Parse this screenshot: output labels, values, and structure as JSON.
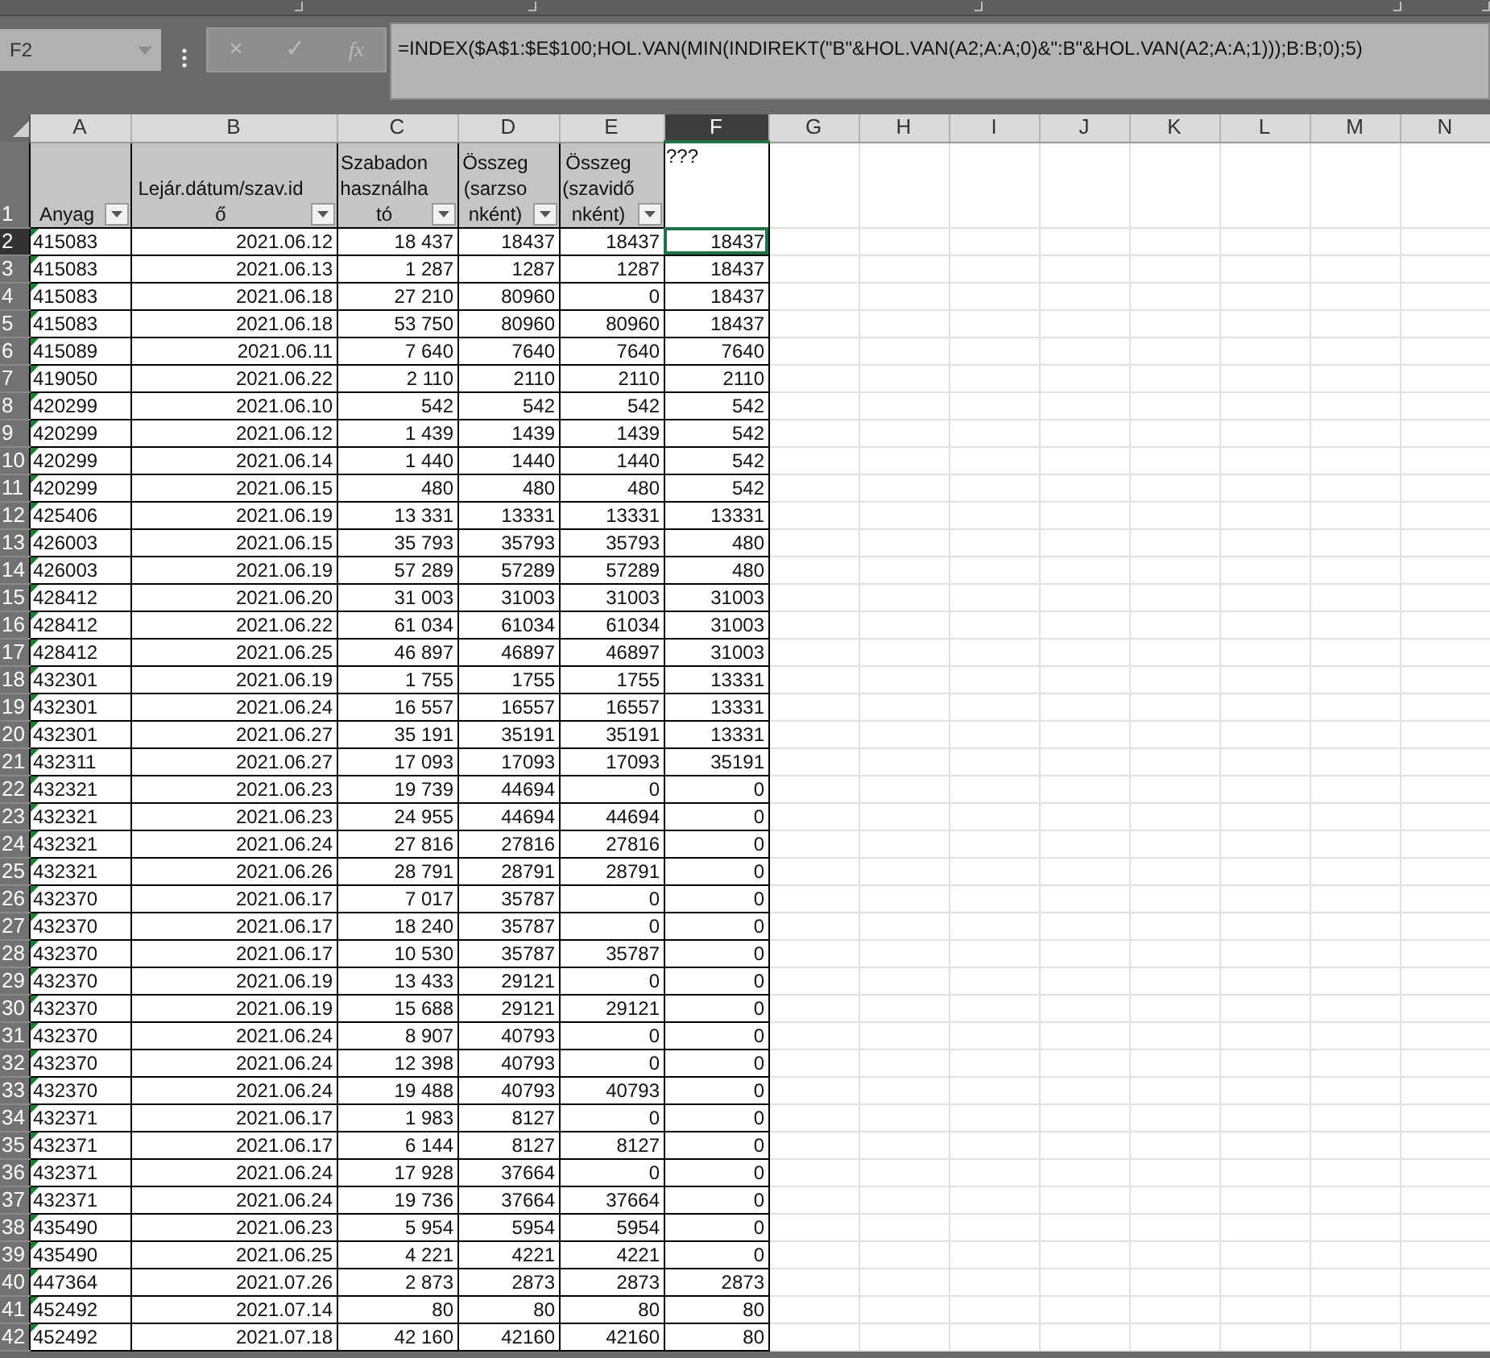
{
  "formula_bar": {
    "name_box": "F2",
    "cancel": "×",
    "enter": "✓",
    "function": "fx",
    "formula": "=INDEX($A$1:$E$100;HOL.VAN(MIN(INDIREKT(\"B\"&HOL.VAN(A2;A:A;0)&\":B\"&HOL.VAN(A2;A:A;1)));B:B;0);5)"
  },
  "columns": [
    {
      "letter": "A",
      "selected": false,
      "flagged": true
    },
    {
      "letter": "B",
      "selected": false,
      "flagged": false
    },
    {
      "letter": "C",
      "selected": false,
      "flagged": false
    },
    {
      "letter": "D",
      "selected": false,
      "flagged": false
    },
    {
      "letter": "E",
      "selected": false,
      "flagged": false
    },
    {
      "letter": "F",
      "selected": true,
      "flagged": false
    },
    {
      "letter": "G",
      "selected": false
    },
    {
      "letter": "H",
      "selected": false
    },
    {
      "letter": "I",
      "selected": false
    },
    {
      "letter": "J",
      "selected": false
    },
    {
      "letter": "K",
      "selected": false
    },
    {
      "letter": "L",
      "selected": false
    },
    {
      "letter": "M",
      "selected": false
    },
    {
      "letter": "N",
      "selected": false
    }
  ],
  "header_row": {
    "number": "1",
    "selected": false,
    "cells": [
      {
        "text": "Anyag",
        "kind": "filtered"
      },
      {
        "text": "Lejár.dátum/szav.idő",
        "kind": "filtered"
      },
      {
        "text": "Szabadon használható",
        "kind": "filtered"
      },
      {
        "text": "Összeg (sarzsonként)",
        "kind": "filtered"
      },
      {
        "text": "Összeg (szavidőnként)",
        "kind": "filtered"
      },
      {
        "text": "???",
        "kind": "plain"
      }
    ]
  },
  "rows": [
    {
      "number": "2",
      "selected": true,
      "cells": [
        "415083",
        "2021.06.12",
        "18 437",
        "18437",
        "18437",
        "18437"
      ]
    },
    {
      "number": "3",
      "selected": false,
      "cells": [
        "415083",
        "2021.06.13",
        "1 287",
        "1287",
        "1287",
        "18437"
      ]
    },
    {
      "number": "4",
      "selected": false,
      "cells": [
        "415083",
        "2021.06.18",
        "27 210",
        "80960",
        "0",
        "18437"
      ]
    },
    {
      "number": "5",
      "selected": false,
      "cells": [
        "415083",
        "2021.06.18",
        "53 750",
        "80960",
        "80960",
        "18437"
      ]
    },
    {
      "number": "6",
      "selected": false,
      "cells": [
        "415089",
        "2021.06.11",
        "7 640",
        "7640",
        "7640",
        "7640"
      ]
    },
    {
      "number": "7",
      "selected": false,
      "cells": [
        "419050",
        "2021.06.22",
        "2 110",
        "2110",
        "2110",
        "2110"
      ]
    },
    {
      "number": "8",
      "selected": false,
      "cells": [
        "420299",
        "2021.06.10",
        "542",
        "542",
        "542",
        "542"
      ]
    },
    {
      "number": "9",
      "selected": false,
      "cells": [
        "420299",
        "2021.06.12",
        "1 439",
        "1439",
        "1439",
        "542"
      ]
    },
    {
      "number": "10",
      "selected": false,
      "cells": [
        "420299",
        "2021.06.14",
        "1 440",
        "1440",
        "1440",
        "542"
      ]
    },
    {
      "number": "11",
      "selected": false,
      "cells": [
        "420299",
        "2021.06.15",
        "480",
        "480",
        "480",
        "542"
      ]
    },
    {
      "number": "12",
      "selected": false,
      "cells": [
        "425406",
        "2021.06.19",
        "13 331",
        "13331",
        "13331",
        "13331"
      ]
    },
    {
      "number": "13",
      "selected": false,
      "cells": [
        "426003",
        "2021.06.15",
        "35 793",
        "35793",
        "35793",
        "480"
      ]
    },
    {
      "number": "14",
      "selected": false,
      "cells": [
        "426003",
        "2021.06.19",
        "57 289",
        "57289",
        "57289",
        "480"
      ]
    },
    {
      "number": "15",
      "selected": false,
      "cells": [
        "428412",
        "2021.06.20",
        "31 003",
        "31003",
        "31003",
        "31003"
      ]
    },
    {
      "number": "16",
      "selected": false,
      "cells": [
        "428412",
        "2021.06.22",
        "61 034",
        "61034",
        "61034",
        "31003"
      ]
    },
    {
      "number": "17",
      "selected": false,
      "cells": [
        "428412",
        "2021.06.25",
        "46 897",
        "46897",
        "46897",
        "31003"
      ]
    },
    {
      "number": "18",
      "selected": false,
      "cells": [
        "432301",
        "2021.06.19",
        "1 755",
        "1755",
        "1755",
        "13331"
      ]
    },
    {
      "number": "19",
      "selected": false,
      "cells": [
        "432301",
        "2021.06.24",
        "16 557",
        "16557",
        "16557",
        "13331"
      ]
    },
    {
      "number": "20",
      "selected": false,
      "cells": [
        "432301",
        "2021.06.27",
        "35 191",
        "35191",
        "35191",
        "13331"
      ]
    },
    {
      "number": "21",
      "selected": false,
      "cells": [
        "432311",
        "2021.06.27",
        "17 093",
        "17093",
        "17093",
        "35191"
      ]
    },
    {
      "number": "22",
      "selected": false,
      "cells": [
        "432321",
        "2021.06.23",
        "19 739",
        "44694",
        "0",
        "0"
      ]
    },
    {
      "number": "23",
      "selected": false,
      "cells": [
        "432321",
        "2021.06.23",
        "24 955",
        "44694",
        "44694",
        "0"
      ]
    },
    {
      "number": "24",
      "selected": false,
      "cells": [
        "432321",
        "2021.06.24",
        "27 816",
        "27816",
        "27816",
        "0"
      ]
    },
    {
      "number": "25",
      "selected": false,
      "cells": [
        "432321",
        "2021.06.26",
        "28 791",
        "28791",
        "28791",
        "0"
      ]
    },
    {
      "number": "26",
      "selected": false,
      "cells": [
        "432370",
        "2021.06.17",
        "7 017",
        "35787",
        "0",
        "0"
      ]
    },
    {
      "number": "27",
      "selected": false,
      "cells": [
        "432370",
        "2021.06.17",
        "18 240",
        "35787",
        "0",
        "0"
      ]
    },
    {
      "number": "28",
      "selected": false,
      "cells": [
        "432370",
        "2021.06.17",
        "10 530",
        "35787",
        "35787",
        "0"
      ]
    },
    {
      "number": "29",
      "selected": false,
      "cells": [
        "432370",
        "2021.06.19",
        "13 433",
        "29121",
        "0",
        "0"
      ]
    },
    {
      "number": "30",
      "selected": false,
      "cells": [
        "432370",
        "2021.06.19",
        "15 688",
        "29121",
        "29121",
        "0"
      ]
    },
    {
      "number": "31",
      "selected": false,
      "cells": [
        "432370",
        "2021.06.24",
        "8 907",
        "40793",
        "0",
        "0"
      ]
    },
    {
      "number": "32",
      "selected": false,
      "cells": [
        "432370",
        "2021.06.24",
        "12 398",
        "40793",
        "0",
        "0"
      ]
    },
    {
      "number": "33",
      "selected": false,
      "cells": [
        "432370",
        "2021.06.24",
        "19 488",
        "40793",
        "40793",
        "0"
      ]
    },
    {
      "number": "34",
      "selected": false,
      "cells": [
        "432371",
        "2021.06.17",
        "1 983",
        "8127",
        "0",
        "0"
      ]
    },
    {
      "number": "35",
      "selected": false,
      "cells": [
        "432371",
        "2021.06.17",
        "6 144",
        "8127",
        "8127",
        "0"
      ]
    },
    {
      "number": "36",
      "selected": false,
      "cells": [
        "432371",
        "2021.06.24",
        "17 928",
        "37664",
        "0",
        "0"
      ]
    },
    {
      "number": "37",
      "selected": false,
      "cells": [
        "432371",
        "2021.06.24",
        "19 736",
        "37664",
        "37664",
        "0"
      ]
    },
    {
      "number": "38",
      "selected": false,
      "cells": [
        "435490",
        "2021.06.23",
        "5 954",
        "5954",
        "5954",
        "0"
      ]
    },
    {
      "number": "39",
      "selected": false,
      "cells": [
        "435490",
        "2021.06.25",
        "4 221",
        "4221",
        "4221",
        "0"
      ]
    },
    {
      "number": "40",
      "selected": false,
      "cells": [
        "447364",
        "2021.07.26",
        "2 873",
        "2873",
        "2873",
        "2873"
      ]
    },
    {
      "number": "41",
      "selected": false,
      "cells": [
        "452492",
        "2021.07.14",
        "80",
        "80",
        "80",
        "80"
      ]
    },
    {
      "number": "42",
      "selected": false,
      "cells": [
        "452492",
        "2021.07.18",
        "42 160",
        "42160",
        "42160",
        "80"
      ]
    }
  ]
}
